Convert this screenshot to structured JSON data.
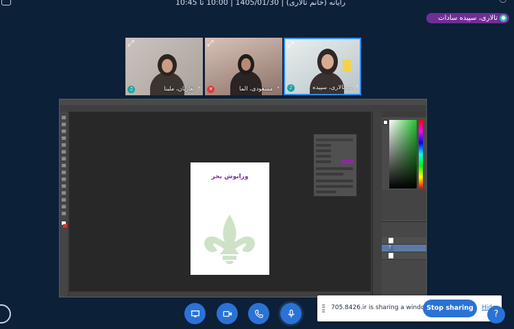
{
  "window": {
    "title": "رایانه (خانم تالاری) | 1405/01/30 | 10:00 تا 10:45"
  },
  "active_speaker": {
    "name": "تالاری، سپیده سادات"
  },
  "participants": [
    {
      "name": "تعاریان، ملینا",
      "status": "audio"
    },
    {
      "name": "مسعودی، الما",
      "status": "muted"
    },
    {
      "name": "تالاری، سپیده ...",
      "status": "speaking"
    }
  ],
  "shared_document": {
    "title": "ورانوش بخر",
    "colors": {
      "title": "#7b2d9a",
      "ornament": "#cfe2c8"
    }
  },
  "controls": [
    "share-screen",
    "video",
    "phone",
    "microphone"
  ],
  "share_bar": {
    "message": "705.8426.ir is sharing a window.",
    "stop_label": "Stop sharing",
    "hide_label": "Hide"
  },
  "accent_color": "#2a72d6"
}
